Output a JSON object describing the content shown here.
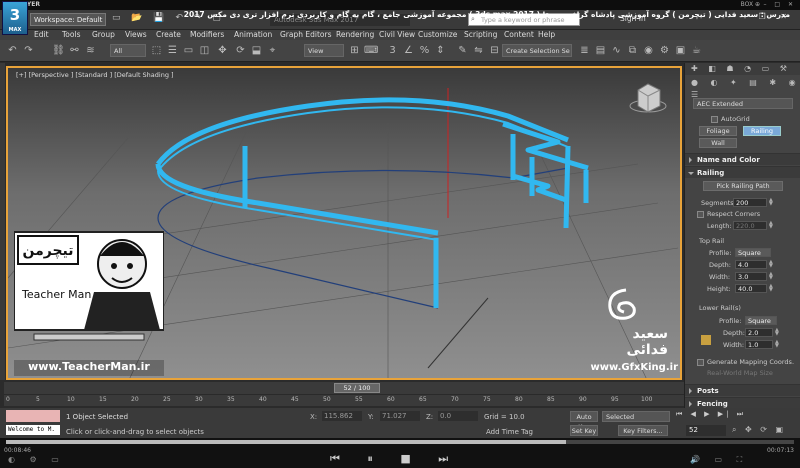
{
  "player": {
    "name": "KMPLAYER",
    "box": "BOX ⊕",
    "elapsed": "00:08:46",
    "total": "00:07:13"
  },
  "title": {
    "workspace": "Workspace: Default",
    "banner": "Autodesk 3ds Max 2017",
    "persian": "مجموعه آموزشی جامع ، گام به گام و کاربردی نرم افزار تری دی مکس 2017 ( 3ds max 2017 )  مدرس : سعید فدایی ( تیچرمن ) گروه آموزشی پادشاه گرافیست ها",
    "search_placeholder": "Type a keyword or phrase",
    "signin": "Sign In",
    "logo": "3",
    "logo_sub": "MAX"
  },
  "menu": [
    "Edit",
    "Tools",
    "Group",
    "Views",
    "Create",
    "Modifiers",
    "Animation",
    "Graph Editors",
    "Rendering",
    "Civil View",
    "Customize",
    "Scripting",
    "Content",
    "Help"
  ],
  "toolbar": {
    "filter": "All",
    "refcoord": "View",
    "selset": "Create Selection Se"
  },
  "viewport": {
    "label": "[+] [Perspective ] [Standard ] [Default Shading ]"
  },
  "command_panel": {
    "category": "AEC Extended",
    "autogrid": "AutoGrid",
    "buttons": [
      "Foliage",
      "Railing",
      "Wall"
    ],
    "rollouts": {
      "name_color": "Name and Color",
      "railing": "Railing",
      "posts": "Posts",
      "fencing": "Fencing"
    },
    "pick_path": "Pick Railing Path",
    "segments_label": "Segments:",
    "segments": "200",
    "respect_corners": "Respect Corners",
    "length_label": "Length:",
    "length": "220.0",
    "top_rail": "Top Rail",
    "profile_label": "Profile:",
    "profile": "Square",
    "depth_label": "Depth:",
    "depth": "4.0",
    "width_label": "Width:",
    "width": "3.0",
    "height_label": "Height:",
    "height": "40.0",
    "lower_rails": "Lower Rail(s)",
    "lprofile": "Square",
    "ldepth": "2.0",
    "lwidth": "1.0",
    "gen_mapping": "Generate Mapping Coords.",
    "real_world": "Real-World Map Size"
  },
  "timeline": {
    "frame": "52 / 100",
    "ticks": [
      "0",
      "5",
      "10",
      "15",
      "20",
      "25",
      "30",
      "35",
      "40",
      "45",
      "50",
      "55",
      "60",
      "65",
      "70",
      "75",
      "80",
      "85",
      "90",
      "95",
      "100"
    ]
  },
  "status": {
    "selected": "1 Object Selected",
    "prompt": "Click or click-and-drag to select objects",
    "x_label": "X:",
    "x": "115.862",
    "y_label": "Y:",
    "y": "71.027",
    "z_label": "Z:",
    "z": "0.0",
    "grid": "Grid = 10.0",
    "addtag": "Add Time Tag",
    "autokey": "Auto Key",
    "setkey": "Set Key",
    "selected_dd": "Selected",
    "keyfilters": "Key Filters...",
    "frame": "52",
    "welcome": "Welcome to M."
  },
  "watermark": {
    "teacherman_url": "www.TeacherMan.ir",
    "teacherman": "Teacher Man",
    "teacherman_fa": "تیچرمن",
    "gfx_url": "www.GfxKing.ir",
    "gfx_name": "سعید فدائی"
  },
  "colors": {
    "railing": "#31b8f0",
    "highlight": "#e8a33a",
    "accent": "#7aa9d8"
  }
}
